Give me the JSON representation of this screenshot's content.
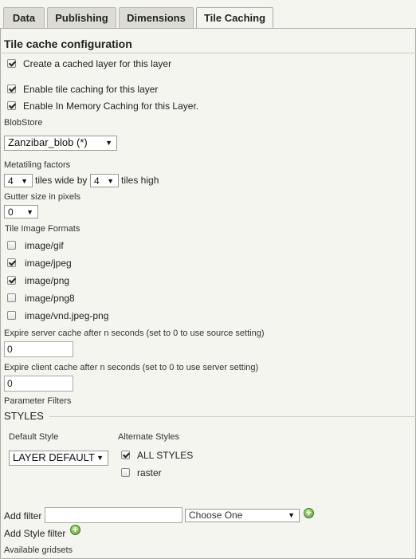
{
  "tabs": [
    "Data",
    "Publishing",
    "Dimensions",
    "Tile Caching"
  ],
  "section_title": "Tile cache configuration",
  "options": {
    "create_cached_layer": {
      "label": "Create a cached layer for this layer",
      "checked": true
    },
    "enable_tile_caching": {
      "label": "Enable tile caching for this layer",
      "checked": true
    },
    "enable_in_memory": {
      "label": "Enable In Memory Caching for this Layer.",
      "checked": true
    }
  },
  "blobstore": {
    "label": "BlobStore",
    "value": "Zanzibar_blob (*)"
  },
  "metatiling": {
    "label": "Metatiling factors",
    "wide": "4",
    "wide_text": "tiles wide by",
    "high": "4",
    "high_text": "tiles high"
  },
  "gutter": {
    "label": "Gutter size in pixels",
    "value": "0"
  },
  "formats": {
    "label": "Tile Image Formats",
    "items": [
      {
        "label": "image/gif",
        "checked": false
      },
      {
        "label": "image/jpeg",
        "checked": true
      },
      {
        "label": "image/png",
        "checked": true
      },
      {
        "label": "image/png8",
        "checked": false
      },
      {
        "label": "image/vnd.jpeg-png",
        "checked": false
      }
    ]
  },
  "expire_server": {
    "label": "Expire server cache after n seconds (set to 0 to use source setting)",
    "value": "0"
  },
  "expire_client": {
    "label": "Expire client cache after n seconds (set to 0 to use server setting)",
    "value": "0"
  },
  "parameter_filters": "Parameter Filters",
  "styles": {
    "title": "STYLES",
    "default_label": "Default Style",
    "default_value": "LAYER DEFAULT",
    "alternate_label": "Alternate Styles",
    "alternates": [
      {
        "label": "ALL STYLES",
        "checked": true
      },
      {
        "label": "raster",
        "checked": false
      }
    ]
  },
  "add_filter": {
    "label": "Add filter",
    "input_value": "",
    "select_value": "Choose One"
  },
  "add_style_filter": "Add Style filter",
  "available_gridsets": "Available gridsets"
}
